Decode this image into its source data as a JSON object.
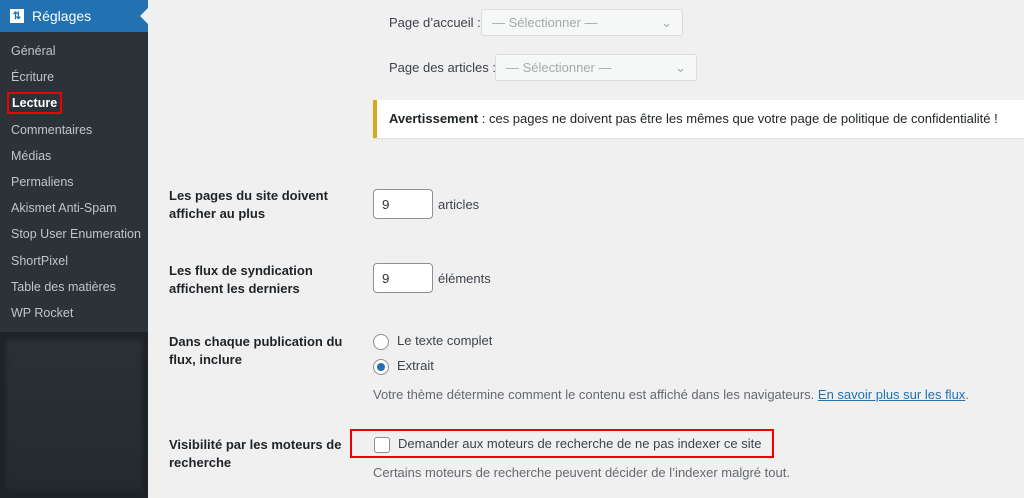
{
  "sidebar": {
    "title": "Réglages",
    "items": [
      "Général",
      "Écriture",
      "Lecture",
      "Commentaires",
      "Médias",
      "Permaliens",
      "Akismet Anti-Spam",
      "Stop User Enumeration",
      "ShortPixel",
      "Table des matières",
      "WP Rocket"
    ]
  },
  "main": {
    "front_page_label": "Page d’accueil :",
    "posts_page_label": "Page des articles :",
    "select_placeholder": "— Sélectionner —",
    "warning_bold": "Avertissement",
    "warning_text": " : ces pages ne doivent pas être les mêmes que votre page de politique de confidentialité !",
    "posts_per_page_label": "Les pages du site doivent afficher au plus",
    "posts_per_page_value": "9",
    "posts_unit": "articles",
    "feed_label": "Les flux de syndication affichent les derniers",
    "feed_value": "9",
    "feed_unit": "éléments",
    "feed_content_label": "Dans chaque publication du flux, inclure",
    "radio_full": "Le texte complet",
    "radio_excerpt": "Extrait",
    "feed_desc": "Votre thème détermine comment le contenu est affiché dans les navigateurs. ",
    "feed_link": "En savoir plus sur les flux",
    "feed_desc_end": ".",
    "visibility_label": "Visibilité par les moteurs de recherche",
    "noindex_label": "Demander aux moteurs de recherche de ne pas indexer ce site",
    "noindex_desc": "Certains moteurs de recherche peuvent décider de l’indexer malgré tout."
  }
}
